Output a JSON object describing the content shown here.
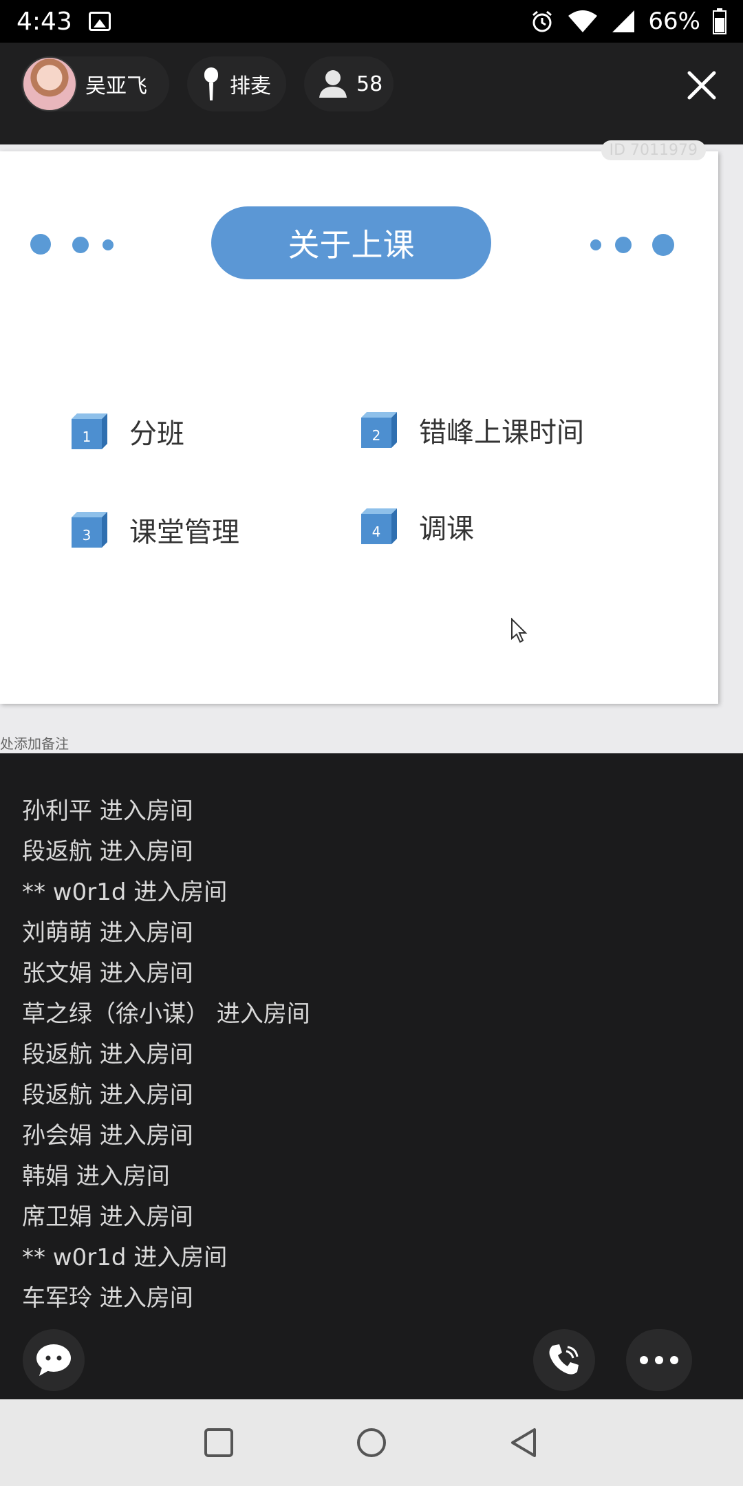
{
  "status_bar": {
    "time": "4:43",
    "battery": "66%",
    "icons": [
      "image-icon",
      "alarm-icon",
      "wifi-icon",
      "signal-icon",
      "battery-icon"
    ]
  },
  "header": {
    "host_name": "吴亚飞",
    "queue_label": "排麦",
    "audience_count": "58",
    "room_id": "ID 7011979"
  },
  "slide": {
    "title": "关于上课",
    "items": [
      {
        "num": "1",
        "label": "分班"
      },
      {
        "num": "2",
        "label": "错峰上课时间"
      },
      {
        "num": "3",
        "label": "课堂管理"
      },
      {
        "num": "4",
        "label": "调课"
      }
    ],
    "note": "处添加备注"
  },
  "chat": {
    "messages": [
      "孙利平 进入房间",
      "段返航 进入房间",
      "** w0r1d 进入房间",
      "刘萌萌 进入房间",
      "张文娟 进入房间",
      "草之绿（徐小谋） 进入房间",
      "段返航 进入房间",
      "段返航 进入房间",
      "孙会娟 进入房间",
      "韩娟 进入房间",
      "席卫娟 进入房间",
      "** w0r1d 进入房间",
      "车军玲 进入房间"
    ]
  },
  "colors": {
    "accent": "#5b97d5",
    "background": "#1b1b1c",
    "chat_text": "#d9d9d9"
  }
}
